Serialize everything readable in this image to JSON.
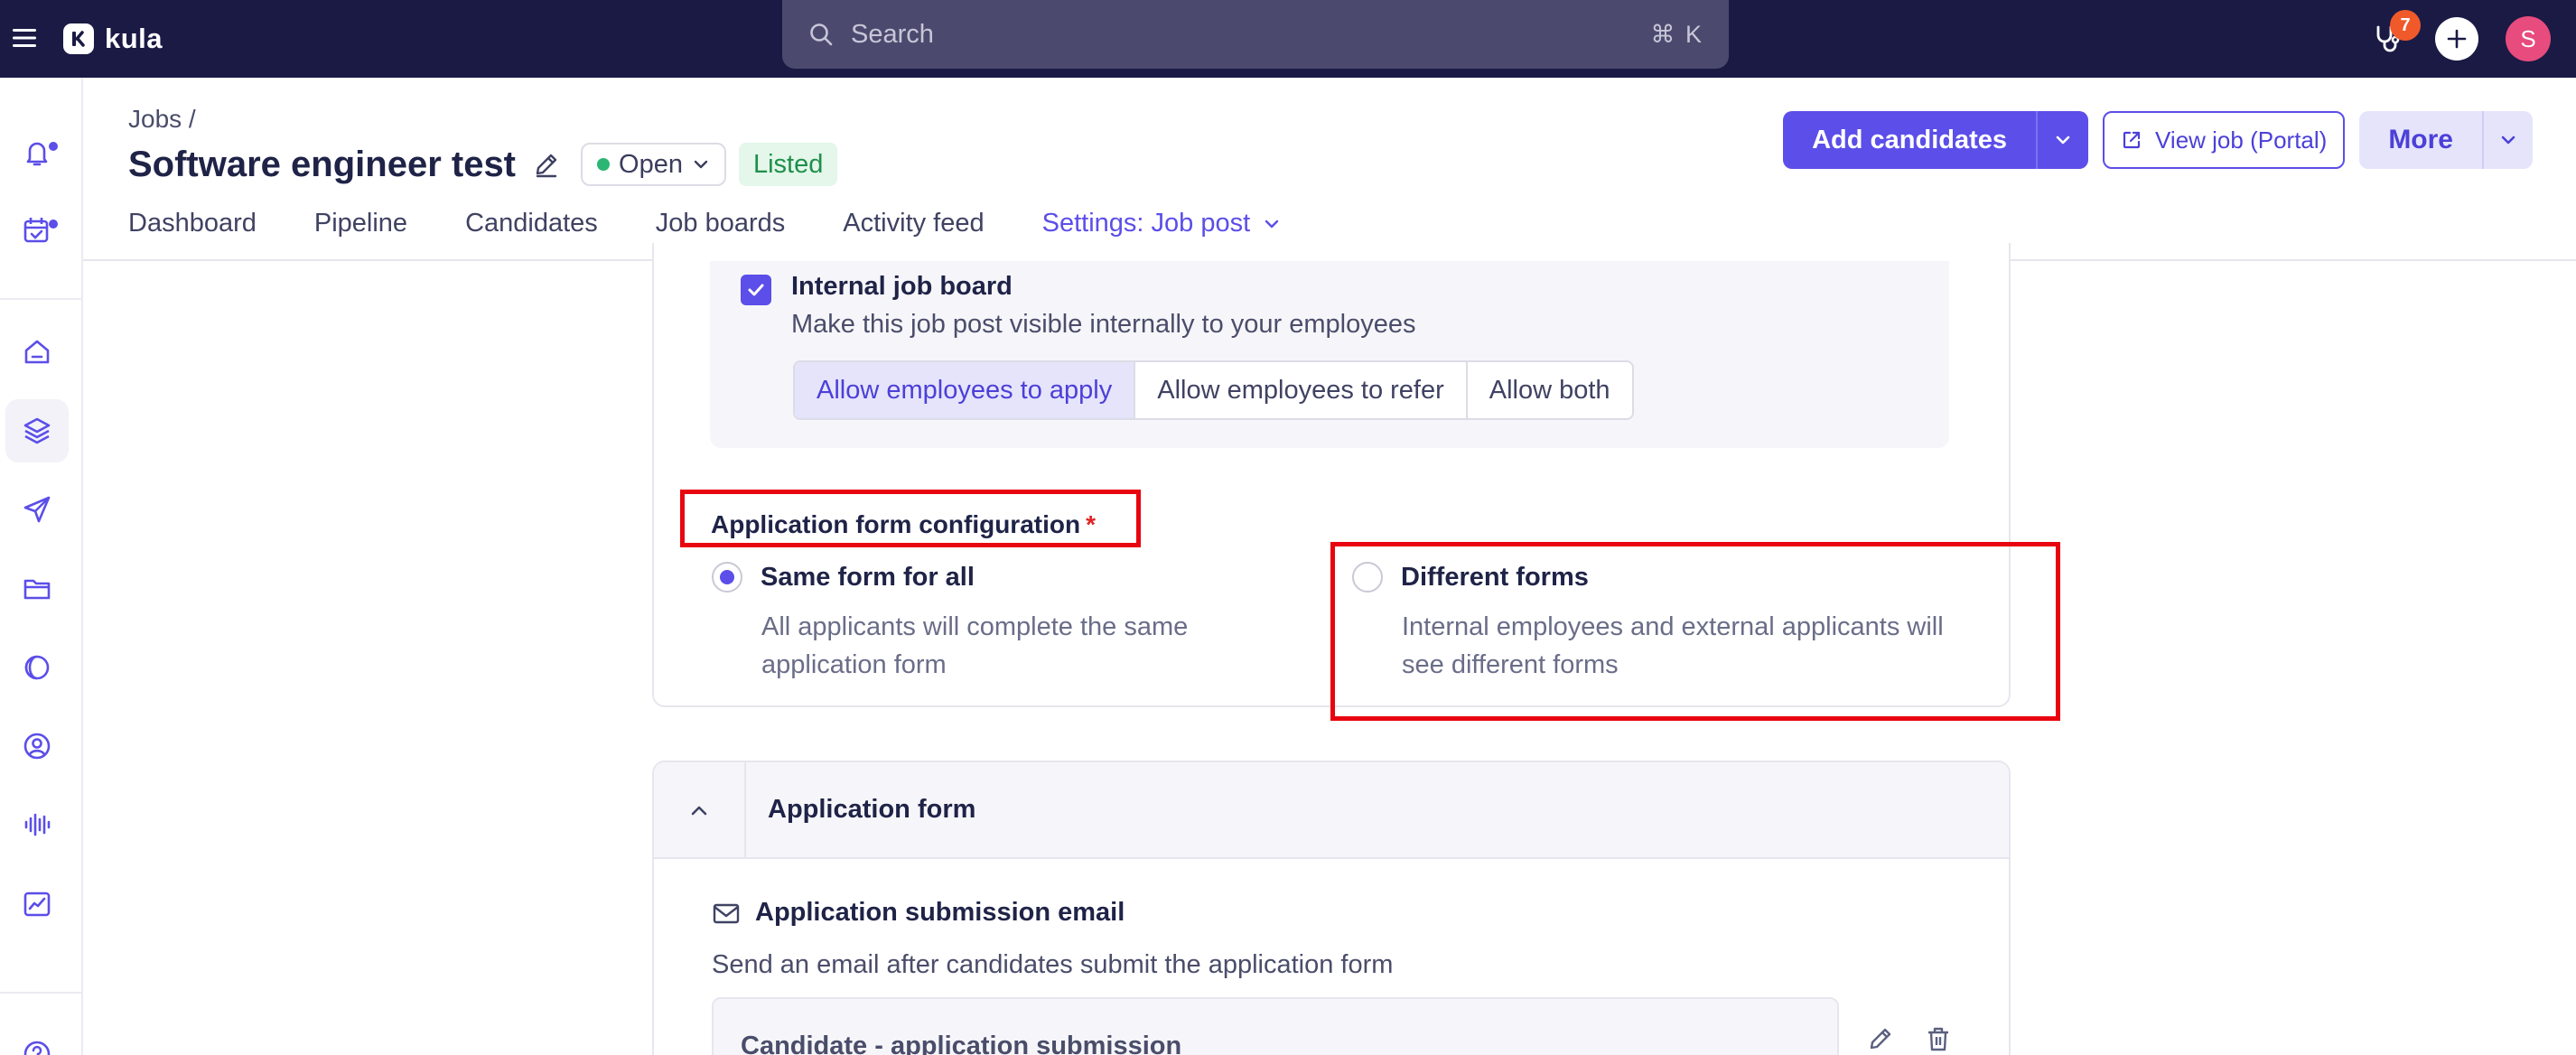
{
  "topbar": {
    "brand": "kula",
    "search_placeholder": "Search",
    "search_shortcut": "⌘ K",
    "notification_count": "7",
    "avatar_initial": "S",
    "colors": {
      "background": "#1b1a45",
      "badge": "#f05a2a",
      "avatar": "#e84b7d"
    }
  },
  "rail": {
    "items": [
      "bell-icon",
      "calendar-check-icon",
      "home-icon",
      "layers-icon",
      "send-icon",
      "folder-icon",
      "moon-icon",
      "user-circle-icon",
      "audio-waveform-icon",
      "chart-icon",
      "help-icon"
    ],
    "active": "layers-icon"
  },
  "header": {
    "breadcrumb": "Jobs /",
    "title": "Software engineer test",
    "status": "Open",
    "listed": "Listed",
    "add_candidates": "Add candidates",
    "view_job": "View job (Portal)",
    "more": "More",
    "tabs": [
      {
        "label": "Dashboard"
      },
      {
        "label": "Pipeline"
      },
      {
        "label": "Candidates"
      },
      {
        "label": "Job boards"
      },
      {
        "label": "Activity feed"
      },
      {
        "label": "Settings: Job post",
        "active": true
      }
    ]
  },
  "internal_job_board": {
    "checked": true,
    "title": "Internal job board",
    "description": "Make this job post visible internally to your employees",
    "options": [
      "Allow employees to apply",
      "Allow employees to refer",
      "Allow both"
    ],
    "selected": "Allow employees to apply"
  },
  "application_form_config": {
    "label": "Application form configuration",
    "required_mark": "*",
    "options": [
      {
        "label": "Same form for all",
        "description": "All applicants will complete the same application form",
        "checked": true
      },
      {
        "label": "Different forms",
        "description": "Internal employees and external applicants will see different forms",
        "checked": false
      }
    ]
  },
  "application_form": {
    "title": "Application form",
    "email_title": "Application submission email",
    "email_description": "Send an email after candidates submit the application form",
    "template_name": "Candidate - application submission"
  },
  "colors": {
    "accent": "#5b4ee9",
    "highlight": "#e8050f",
    "success": "#2bb673"
  }
}
